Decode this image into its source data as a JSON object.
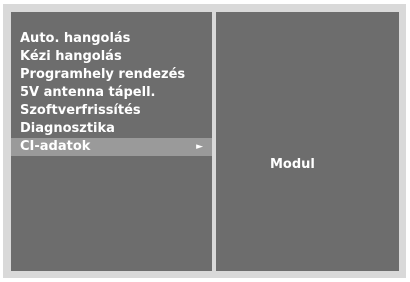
{
  "menu": {
    "items": [
      {
        "label": "Auto. hangolás"
      },
      {
        "label": "Kézi hangolás"
      },
      {
        "label": "Programhely rendezés"
      },
      {
        "label": "5V antenna tápell."
      },
      {
        "label": "Szoftverfrissítés"
      },
      {
        "label": "Diagnosztika"
      },
      {
        "label": "CI-adatok",
        "selected": true,
        "arrow": "►"
      }
    ]
  },
  "submenu": {
    "items": [
      {
        "label": "Modul"
      }
    ]
  },
  "colors": {
    "frame": "#d9d9d9",
    "panel": "#6d6d6d",
    "selected_row": "#9a9a9a",
    "text": "#ffffff"
  }
}
